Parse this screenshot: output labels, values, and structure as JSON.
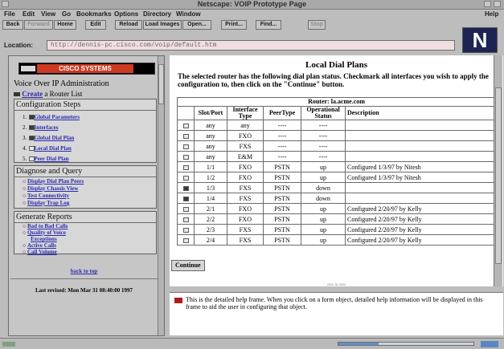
{
  "window": {
    "title": "Netscape: VOIP Prototype Page"
  },
  "menu": [
    "File",
    "Edit",
    "View",
    "Go",
    "Bookmarks",
    "Options",
    "Directory",
    "Window",
    "Help"
  ],
  "toolbar": [
    "Back",
    "Forward",
    "Home",
    "Edit",
    "Reload",
    "Load Images",
    "Open...",
    "Print...",
    "Find...",
    "Stop"
  ],
  "location": {
    "label": "Location:",
    "url": "http://dennis-pc.cisco.com/voip/default.htm"
  },
  "logo_letter": "N",
  "left": {
    "brand": "CISCO SYSTEMS",
    "section_title": "Voice Over IP Administration",
    "create_link": "Create",
    "create_rest": "a Router List",
    "config_title": "Configuration Steps",
    "config_steps": [
      {
        "num": "1.",
        "label": "Global Parameters"
      },
      {
        "num": "2.",
        "label": "Interfaces"
      },
      {
        "num": "3.",
        "label": "Global Dial Plan"
      },
      {
        "num": "4.",
        "label": "Local Dial Plan"
      },
      {
        "num": "5.",
        "label": "Peer Dial Plan"
      }
    ],
    "diag_title": "Diagnose and Query",
    "diag_items": [
      "Display Dial Plan Peers",
      "Display Chassis View",
      "Test Connectivity",
      "Display Trap Log"
    ],
    "reports_title": "Generate Reports",
    "reports_items": [
      "Bad to Bad Calls",
      "Quality of Voice",
      "Exceptions",
      "Active Calls",
      "Call Volume"
    ],
    "back_link": "back to top",
    "last_revised": "Last revised: Mon Mar 31 08:40:00 1997"
  },
  "main": {
    "title": "Local Dial Plans",
    "description": "The selected router has the following dial plan status. Checkmark all interfaces you wish to apply the configuration to, then click on the \"Continue\" button.",
    "router_label": "Router: la.acme.com",
    "columns": [
      "",
      "Slot/Port",
      "Interface Type",
      "PeerType",
      "Operational Status",
      "Description"
    ],
    "rows": [
      {
        "checked": false,
        "slot": "any",
        "itype": "any",
        "peer": "----",
        "status": "----",
        "desc": ""
      },
      {
        "checked": false,
        "slot": "any",
        "itype": "FXO",
        "peer": "----",
        "status": "----",
        "desc": ""
      },
      {
        "checked": false,
        "slot": "any",
        "itype": "FXS",
        "peer": "----",
        "status": "----",
        "desc": ""
      },
      {
        "checked": false,
        "slot": "any",
        "itype": "E&M",
        "peer": "----",
        "status": "----",
        "desc": ""
      },
      {
        "checked": false,
        "slot": "1/1",
        "itype": "FXO",
        "peer": "PSTN",
        "status": "up",
        "desc": "Configured 1/3/97 by Nitesh"
      },
      {
        "checked": false,
        "slot": "1/2",
        "itype": "FXO",
        "peer": "PSTN",
        "status": "up",
        "desc": "Configured 1/3/97 by Nitesh"
      },
      {
        "checked": true,
        "slot": "1/3",
        "itype": "FXS",
        "peer": "PSTN",
        "status": "down",
        "desc": ""
      },
      {
        "checked": true,
        "slot": "1/4",
        "itype": "FXS",
        "peer": "PSTN",
        "status": "down",
        "desc": ""
      },
      {
        "checked": false,
        "slot": "2/1",
        "itype": "FXO",
        "peer": "PSTN",
        "status": "up",
        "desc": "Configured 2/20/97 by Kelly"
      },
      {
        "checked": false,
        "slot": "2/2",
        "itype": "FXO",
        "peer": "PSTN",
        "status": "up",
        "desc": "Configured 2/20/97 by Kelly"
      },
      {
        "checked": false,
        "slot": "2/3",
        "itype": "FXS",
        "peer": "PSTN",
        "status": "up",
        "desc": "Configured 2/20/97 by Kelly"
      },
      {
        "checked": false,
        "slot": "2/4",
        "itype": "FXS",
        "peer": "PSTN",
        "status": "up",
        "desc": "Configured 2/20/97 by Kelly"
      }
    ],
    "continue_label": "Continue",
    "frame_marker": "≈≈ ≈ ≈≈"
  },
  "help": {
    "text": "This is the detailed help frame. When you click on a form object, detailed help information will be displayed in this frame to aid the user in configuring that object."
  },
  "status": {
    "progress": 0.3,
    "colors": {
      "progress": "#5f8fc7",
      "brand": "#cc3a22"
    }
  }
}
